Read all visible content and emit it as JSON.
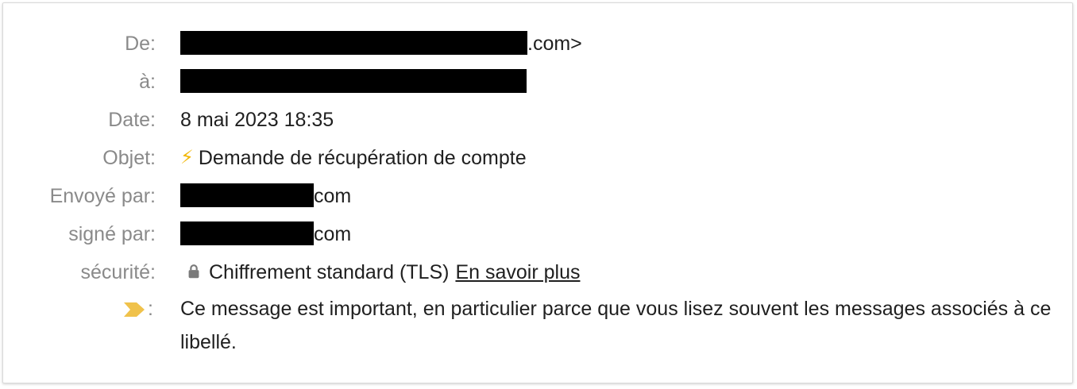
{
  "labels": {
    "from": "De:",
    "to": "à:",
    "date": "Date:",
    "subject": "Objet:",
    "sent_by": "Envoyé par:",
    "signed_by": "signé par:",
    "security": "sécurité:",
    "important_colon": ":"
  },
  "values": {
    "from_suffix": ".com>",
    "date": "8 mai 2023 18:35",
    "subject": "Demande de récupération de compte",
    "sent_by_suffix": "com",
    "signed_by_suffix": "com",
    "security_text": "Chiffrement standard (TLS)",
    "security_link": "En savoir plus",
    "important_message": "Ce message est important, en particulier parce que vous lisez souvent les messages associés à ce libellé."
  },
  "icons": {
    "subject_icon": "lightning-bolt-icon",
    "security_icon": "lock-icon",
    "importance_icon": "importance-marker-icon"
  },
  "colors": {
    "label": "#8a8a8a",
    "text": "#1f1f1f",
    "importance_marker": "#f0c24b",
    "bolt": "#f2b705",
    "redaction": "#000000"
  }
}
